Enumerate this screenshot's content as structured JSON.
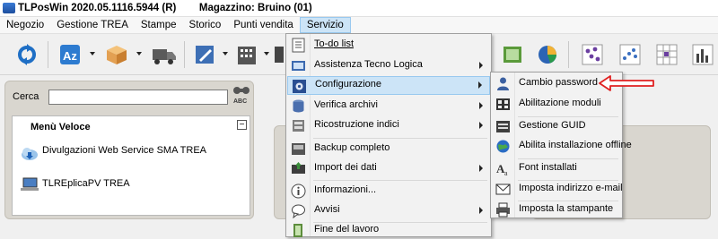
{
  "window": {
    "title": "TLPosWin 2020.05.1116.5944 (R)        Magazzino: Bruino (01)"
  },
  "menubar": {
    "items": [
      {
        "label": "Negozio"
      },
      {
        "label": "Gestione TREA"
      },
      {
        "label": "Stampe"
      },
      {
        "label": "Storico"
      },
      {
        "label": "Punti vendita"
      },
      {
        "label": "Servizio"
      }
    ]
  },
  "search": {
    "label": "Cerca",
    "value": "",
    "abc_icon": "ABC"
  },
  "menu_veloce": {
    "title": "Menù Veloce",
    "items": [
      {
        "label": "Divulgazioni Web Service SMA TREA"
      },
      {
        "label": "TLREplicaPV TREA"
      }
    ]
  },
  "servizio_menu": {
    "items": [
      {
        "label": "To-do list",
        "icon": "todo-list-icon"
      },
      {
        "label": "Assistenza Tecno Logica",
        "icon": "support-icon",
        "submenu": true
      },
      {
        "label": "Configurazione",
        "icon": "gear-icon",
        "submenu": true
      },
      {
        "label": "Verifica archivi",
        "icon": "database-icon",
        "submenu": true
      },
      {
        "label": "Ricostruzione indici",
        "icon": "rebuild-icon",
        "submenu": true
      },
      {
        "label": "Backup completo",
        "icon": "backup-icon"
      },
      {
        "label": "Import dei dati",
        "icon": "import-icon",
        "submenu": true
      },
      {
        "label": "Informazioni...",
        "icon": "info-icon"
      },
      {
        "label": "Avvisi",
        "icon": "chat-icon",
        "submenu": true
      },
      {
        "label": "Fine del lavoro",
        "icon": "exit-icon"
      }
    ]
  },
  "config_submenu": {
    "items": [
      {
        "label": "Cambio password",
        "icon": "user-key-icon"
      },
      {
        "label": "Abilitazione moduli",
        "icon": "modules-icon"
      },
      {
        "label": "Gestione GUID",
        "icon": "guid-icon"
      },
      {
        "label": "Abilita installazione offline",
        "icon": "globe-icon"
      },
      {
        "label": "Font installati",
        "icon": "font-icon"
      },
      {
        "label": "Imposta indirizzo e-mail",
        "icon": "email-icon"
      },
      {
        "label": "Imposta la stampante",
        "icon": "printer-icon"
      }
    ]
  },
  "colors": {
    "highlight": "#cce4f7",
    "annotation_arrow": "#e02020"
  }
}
